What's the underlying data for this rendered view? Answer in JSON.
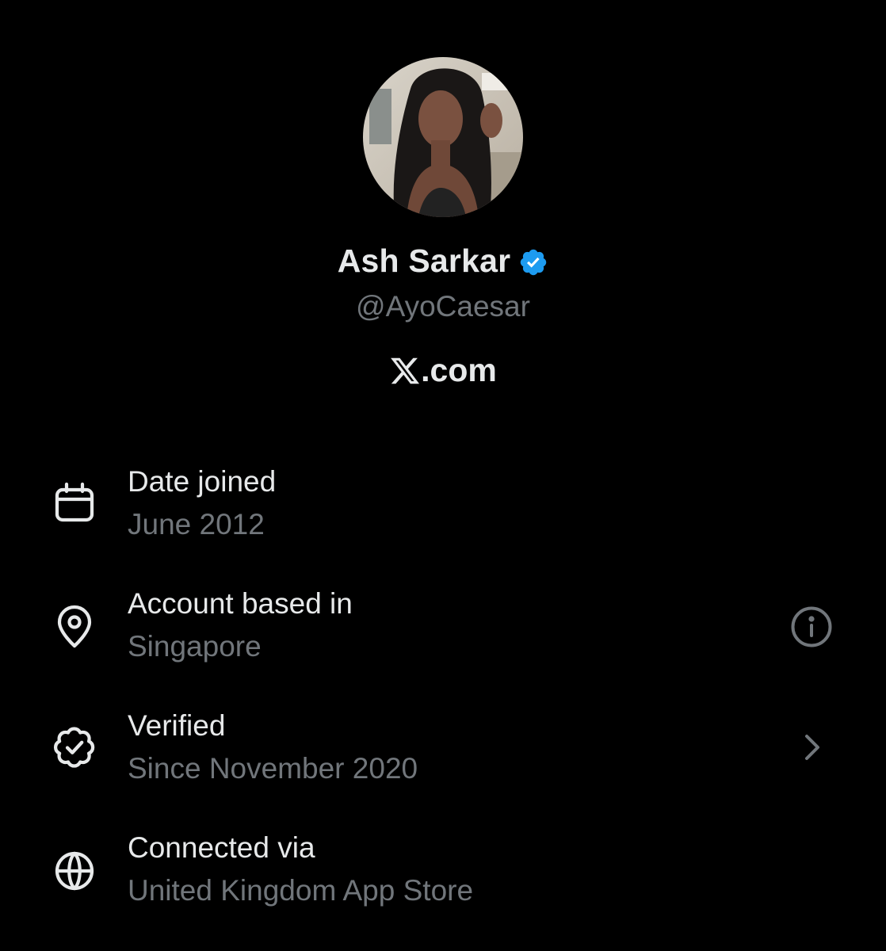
{
  "profile": {
    "display_name": "Ash Sarkar",
    "handle": "@AyoCaesar",
    "verified_badge_color": "#1d9bf0",
    "avatar": "profile-photo"
  },
  "site": {
    "logo": "x-logo",
    "suffix": ".com"
  },
  "about": [
    {
      "icon": "calendar-icon",
      "title": "Date joined",
      "value": "June 2012"
    },
    {
      "icon": "location-pin-icon",
      "title": "Account based in",
      "value": "Singapore",
      "trailing_icon": "info-icon"
    },
    {
      "icon": "verified-seal-icon",
      "title": "Verified",
      "value": "Since November 2020",
      "trailing_icon": "chevron-right-icon"
    },
    {
      "icon": "globe-icon",
      "title": "Connected via",
      "value": "United Kingdom App Store"
    }
  ],
  "colors": {
    "background": "#000000",
    "primary_text": "#e7e9ea",
    "secondary_text": "#71767b",
    "accent": "#1d9bf0"
  }
}
